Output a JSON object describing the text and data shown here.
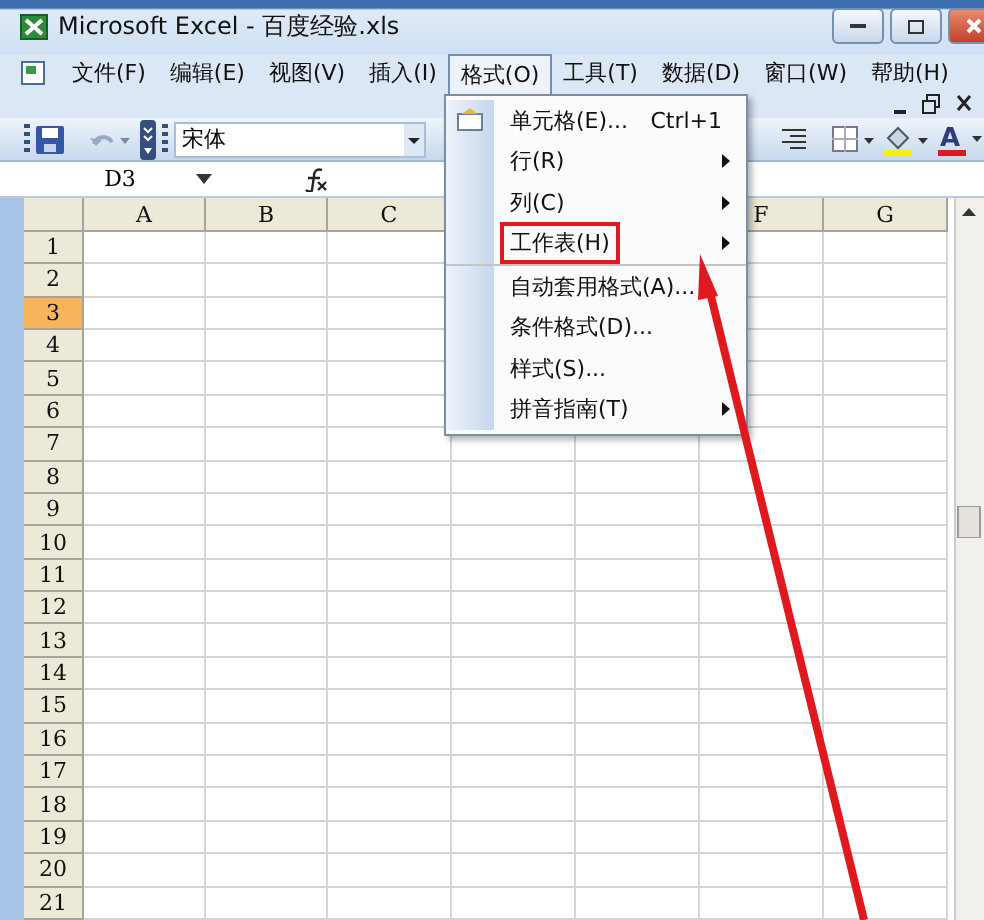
{
  "window": {
    "title": "Microsoft Excel - 百度经验.xls"
  },
  "menu_bar": [
    {
      "label": "文件(F)",
      "selected": false
    },
    {
      "label": "编辑(E)",
      "selected": false
    },
    {
      "label": "视图(V)",
      "selected": false
    },
    {
      "label": "插入(I)",
      "selected": false
    },
    {
      "label": "格式(O)",
      "selected": true
    },
    {
      "label": "工具(T)",
      "selected": false
    },
    {
      "label": "数据(D)",
      "selected": false
    },
    {
      "label": "窗口(W)",
      "selected": false
    },
    {
      "label": "帮助(H)",
      "selected": false
    }
  ],
  "toolbar": {
    "font": "宋体",
    "font_color_label": "A"
  },
  "formula_bar": {
    "name_box": "D3"
  },
  "columns": [
    {
      "label": "A",
      "selected": false
    },
    {
      "label": "B",
      "selected": false
    },
    {
      "label": "C",
      "selected": false
    },
    {},
    {},
    {
      "label": "F",
      "selected": false
    },
    {
      "label": "G",
      "selected": false
    }
  ],
  "rows": [
    {
      "label": "1",
      "selected": false
    },
    {
      "label": "2",
      "selected": false
    },
    {
      "label": "3",
      "selected": true
    },
    {
      "label": "4",
      "selected": false
    },
    {
      "label": "5",
      "selected": false
    },
    {
      "label": "6",
      "selected": false
    },
    {
      "label": "7",
      "selected": false
    },
    {
      "label": "8",
      "selected": false
    },
    {
      "label": "9",
      "selected": false
    },
    {
      "label": "10",
      "selected": false
    },
    {
      "label": "11",
      "selected": false
    },
    {
      "label": "12",
      "selected": false
    },
    {
      "label": "13",
      "selected": false
    },
    {
      "label": "14",
      "selected": false
    },
    {
      "label": "15",
      "selected": false
    },
    {
      "label": "16",
      "selected": false
    },
    {
      "label": "17",
      "selected": false
    },
    {
      "label": "18",
      "selected": false
    },
    {
      "label": "19",
      "selected": false
    },
    {
      "label": "20",
      "selected": false
    },
    {
      "label": "21",
      "selected": false
    }
  ],
  "format_menu": [
    {
      "label": "单元格(E)...",
      "shortcut": "Ctrl+1",
      "submenu": false,
      "highlighted": false,
      "icon": true,
      "separator_before": false
    },
    {
      "label": "行(R)",
      "submenu": true,
      "highlighted": false,
      "icon": false,
      "separator_before": false
    },
    {
      "label": "列(C)",
      "submenu": true,
      "highlighted": false,
      "icon": false,
      "separator_before": false
    },
    {
      "label": "工作表(H)",
      "submenu": true,
      "highlighted": true,
      "icon": false,
      "separator_before": false
    },
    {
      "label": "自动套用格式(A)...",
      "submenu": false,
      "highlighted": false,
      "icon": false,
      "separator_before": true
    },
    {
      "label": "条件格式(D)...",
      "submenu": false,
      "highlighted": false,
      "icon": false,
      "separator_before": false
    },
    {
      "label": "样式(S)...",
      "submenu": false,
      "highlighted": false,
      "icon": false,
      "separator_before": false
    },
    {
      "label": "拼音指南(T)",
      "submenu": true,
      "highlighted": false,
      "icon": false,
      "separator_before": false
    }
  ]
}
